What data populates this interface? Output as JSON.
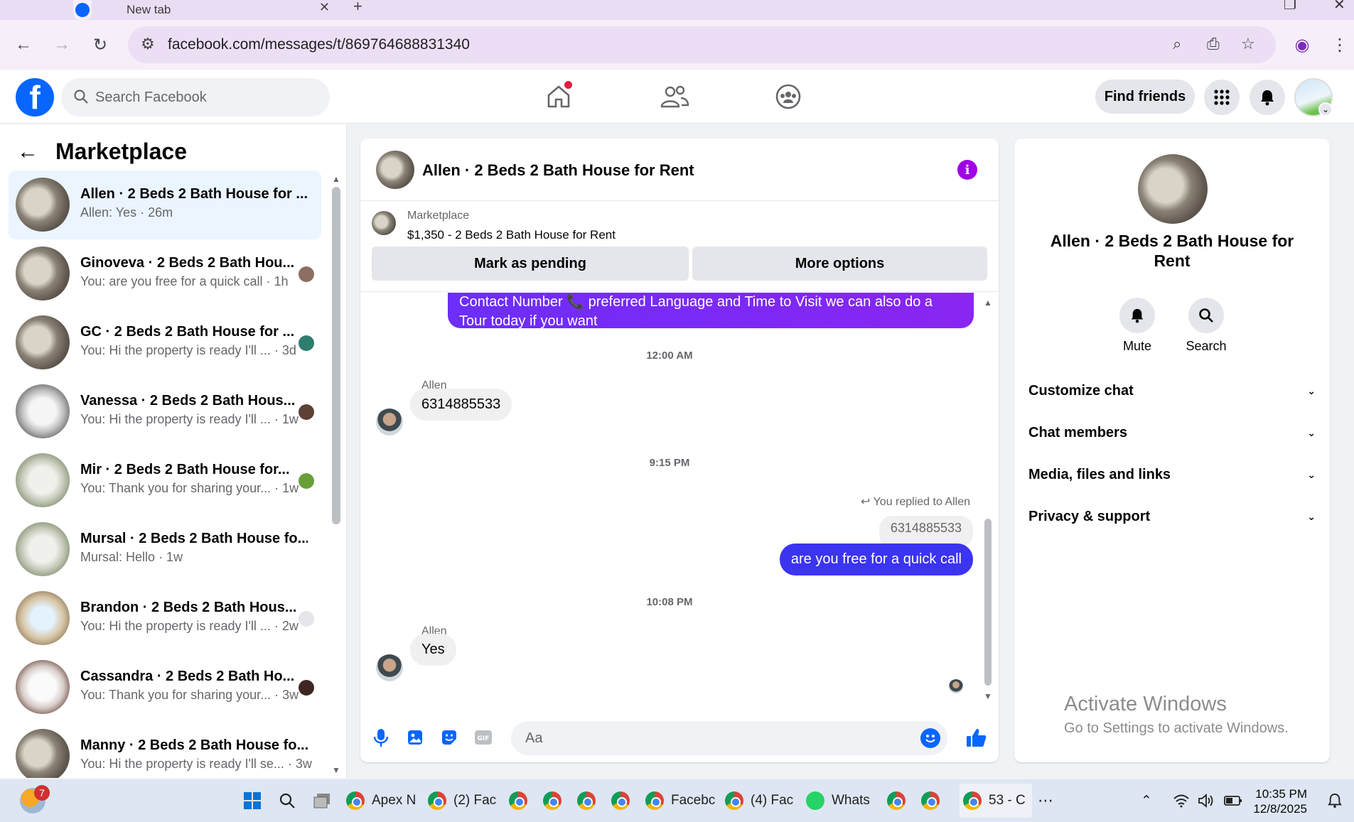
{
  "browser": {
    "tab_title": "New tab",
    "url": "facebook.com/messages/t/869764688831340"
  },
  "header": {
    "search_placeholder": "Search Facebook",
    "find_friends_label": "Find friends"
  },
  "sidebar": {
    "title": "Marketplace",
    "conversations": [
      {
        "title": "Allen · 2 Beds 2 Bath House for ...",
        "snippet": "Allen: Yes · 26m"
      },
      {
        "title": "Ginoveva · 2 Beds 2 Bath Hou...",
        "snippet": "You: are you free for a quick call · 1h"
      },
      {
        "title": "GC · 2 Beds 2 Bath House for ...",
        "snippet": "You: Hi the property is ready I'll ... · 3d"
      },
      {
        "title": "Vanessa · 2 Beds 2 Bath Hous...",
        "snippet": "You: Hi the property is ready I'll ... · 1w"
      },
      {
        "title": "Mir · 2 Beds 2 Bath House for...",
        "snippet": "You: Thank you for sharing your... · 1w"
      },
      {
        "title": "Mursal · 2 Beds 2 Bath House fo...",
        "snippet": "Mursal: Hello · 1w"
      },
      {
        "title": "Brandon · 2 Beds 2 Bath Hous...",
        "snippet": "You: Hi the property is ready I'll ... · 2w"
      },
      {
        "title": "Cassandra · 2 Beds 2 Bath Ho...",
        "snippet": "You: Thank you for sharing your... · 3w"
      },
      {
        "title": "Manny · 2 Beds 2 Bath House fo...",
        "snippet": "You: Hi the property is ready I'll se... · 3w"
      }
    ]
  },
  "chat": {
    "title": "Allen · 2 Beds 2 Bath House for Rent",
    "marketplace_label": "Marketplace",
    "listing": "$1,350 - 2 Beds 2 Bath House for Rent",
    "mark_pending_label": "Mark as pending",
    "more_options_label": "More options",
    "purple_message": "Contact Number 📞 preferred Language and Time to Visit we can also do a Tour today if you want",
    "ts1": "12:00 AM",
    "sender1": "Allen",
    "msg1": "6314885533",
    "ts2": "9:15 PM",
    "reply_note": "You replied to Allen",
    "reply_quote": "6314885533",
    "msg2": "are you free for a quick call",
    "ts3": "10:08 PM",
    "sender2": "Allen",
    "msg3": "Yes",
    "composer_placeholder": "Aa"
  },
  "details": {
    "title": "Allen · 2 Beds 2 Bath House for Rent",
    "mute_label": "Mute",
    "search_label": "Search",
    "sections": [
      "Customize chat",
      "Chat members",
      "Media, files and links",
      "Privacy & support"
    ],
    "watermark_line1": "Activate Windows",
    "watermark_line2": "Go to Settings to activate Windows."
  },
  "taskbar": {
    "weather_badge": "7",
    "items": [
      "Apex N",
      "(2) Fac",
      "Facebc",
      "(4) Fac",
      "Whats",
      "53 - C"
    ],
    "time": "10:35 PM",
    "date": "12/8/2025"
  },
  "colors": {
    "fb_blue": "#0866ff",
    "sent_bubble": "#3b34f0",
    "purple_bubble": "#7b2cff",
    "info_purple": "#a000e6"
  }
}
